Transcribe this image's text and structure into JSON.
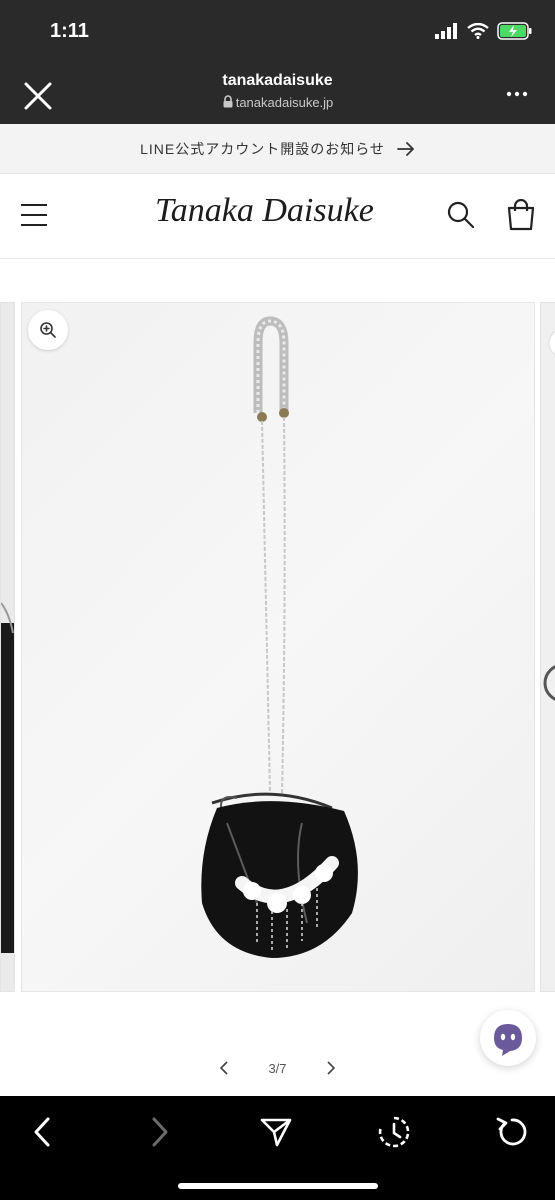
{
  "status_bar": {
    "time": "1:11"
  },
  "browser": {
    "title": "tanakadaisuke",
    "url": "tanakadaisuke.jp"
  },
  "announcement": {
    "text": "LINE公式アカウント開設のお知らせ"
  },
  "header": {
    "logo_text": "Tanaka Daisuke"
  },
  "gallery": {
    "page_indicator": "3/7",
    "current_page": 3,
    "total_pages": 7
  },
  "icons": {
    "close": "close-icon",
    "more": "more-icon",
    "menu": "menu-icon",
    "search": "search-icon",
    "cart": "cart-icon",
    "zoom": "zoom-icon",
    "chat": "chat-icon",
    "back": "back-icon",
    "forward": "forward-icon",
    "share": "share-icon",
    "history": "history-icon",
    "reload": "reload-icon"
  },
  "colors": {
    "browser_bar": "#2a2a2a",
    "toolbar": "#000000",
    "battery": "#4cd964"
  }
}
